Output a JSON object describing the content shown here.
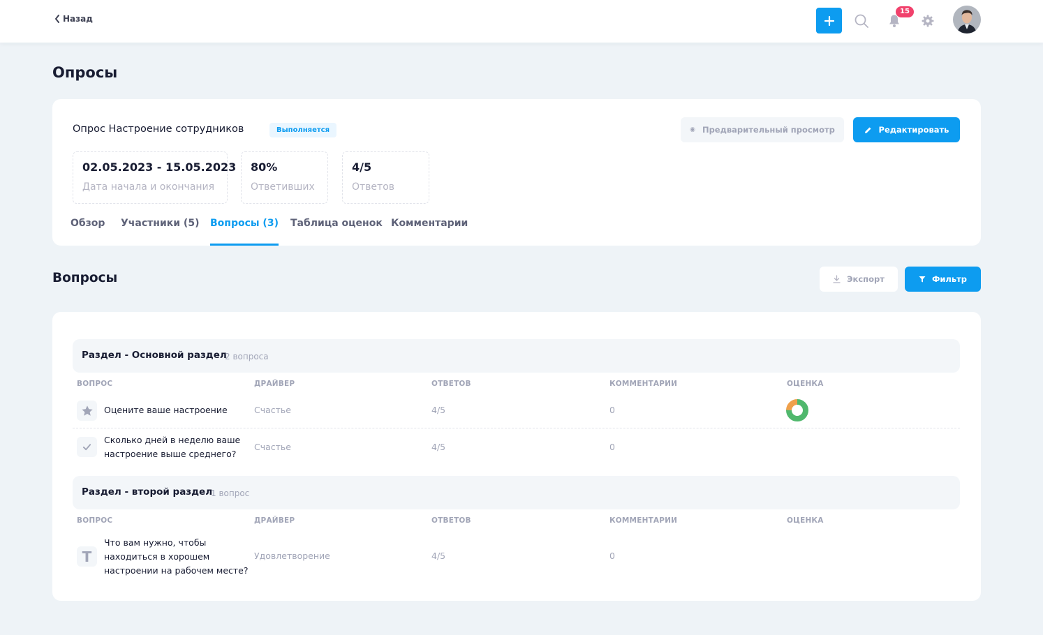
{
  "header": {
    "back_label": "Назад",
    "notifications_count": "15"
  },
  "page_title": "Опросы",
  "survey": {
    "name": "Опрос Настроение сотрудников",
    "status": "Выполняется",
    "preview_label": "Предварительный просмотр",
    "edit_label": "Редактировать",
    "stats": [
      {
        "value": "02.05.2023 - 15.05.2023",
        "label": "Дата начала и окончания"
      },
      {
        "value": "80%",
        "label": "Ответивших"
      },
      {
        "value": "4/5",
        "label": "Ответов"
      }
    ],
    "tabs": [
      {
        "label": "Обзор",
        "active": false
      },
      {
        "label": "Участники (5)",
        "active": false
      },
      {
        "label": "Вопросы (3)",
        "active": true
      },
      {
        "label": "Таблица оценок",
        "active": false
      },
      {
        "label": "Комментарии",
        "active": false
      }
    ]
  },
  "questions_section": {
    "title": "Вопросы",
    "export_label": "Экспорт",
    "filter_label": "Фильтр",
    "columns": [
      "Вопрос",
      "Драйвер",
      "Ответов",
      "Комментарии",
      "Оценка"
    ],
    "groups": [
      {
        "name": "Раздел - Основной раздел",
        "count": "2 вопроса",
        "questions": [
          {
            "icon": "star-icon",
            "text": "Оцените ваше настроение",
            "driver": "Счастье",
            "answers": "4/5",
            "comments": "0",
            "score_chart": {
              "type": "pie",
              "values": [
                75,
                25
              ],
              "colors": [
                "#50b86d",
                "#f0a04b"
              ]
            }
          },
          {
            "icon": "check-icon",
            "text": "Сколько дней в неделю ваше настроение выше среднего?",
            "driver": "Счастье",
            "answers": "4/5",
            "comments": "0"
          }
        ]
      },
      {
        "name": "Раздел - второй раздел",
        "count": "1 вопрос",
        "questions": [
          {
            "icon": "text-icon",
            "text": "Что вам нужно, чтобы находиться в хорошем настроении на рабочем месте?",
            "driver": "Удовлетворение",
            "answers": "4/5",
            "comments": "0"
          }
        ]
      }
    ]
  },
  "colors": {
    "accent": "#0d9cf0",
    "badge": "#f1416c",
    "page_bg": "#eef3f7"
  }
}
